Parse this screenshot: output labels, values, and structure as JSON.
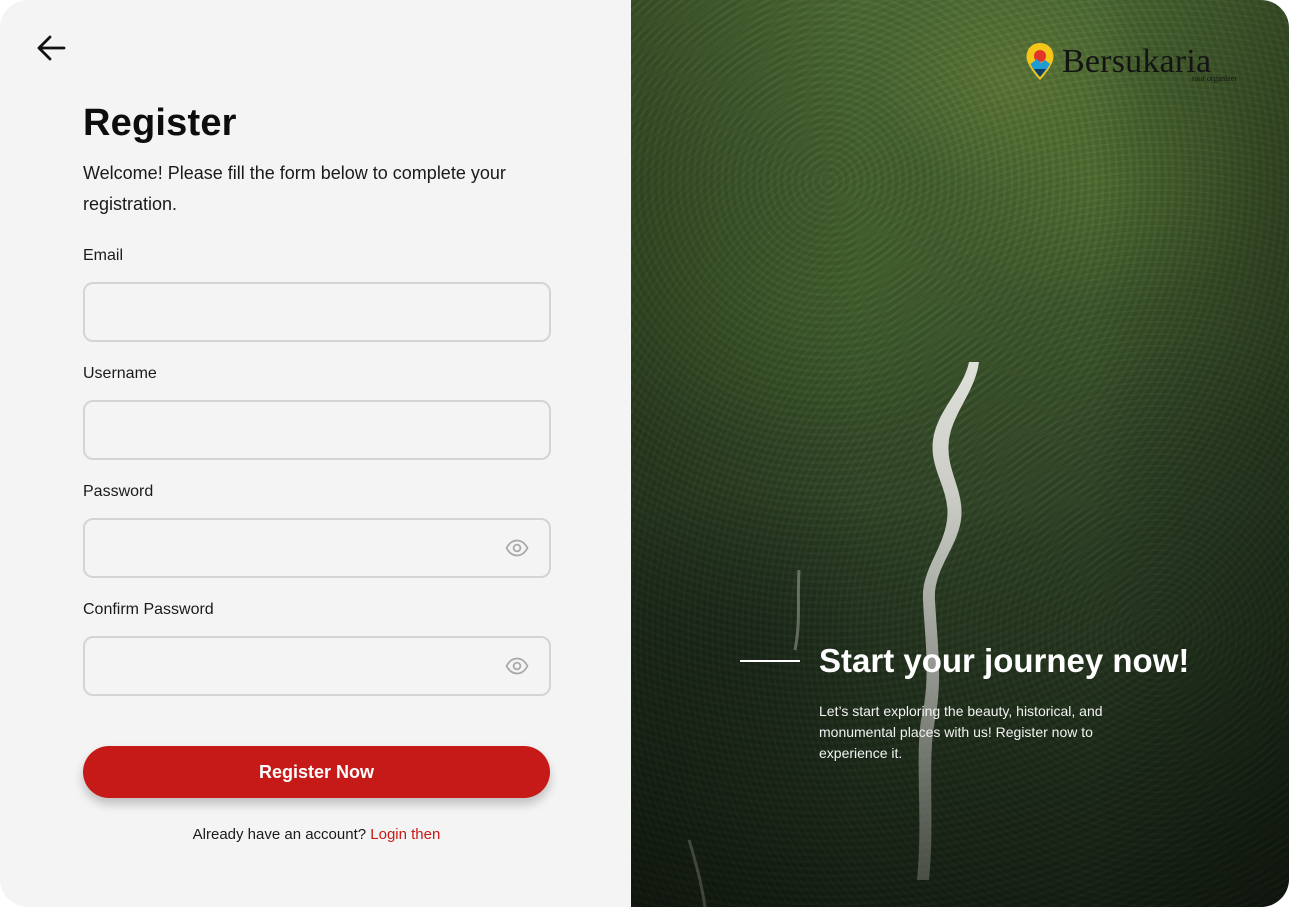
{
  "form": {
    "title": "Register",
    "subtitle": "Welcome! Please fill the form below to complete your registration.",
    "fields": {
      "email": {
        "label": "Email",
        "value": "",
        "placeholder": ""
      },
      "username": {
        "label": "Username",
        "value": "",
        "placeholder": ""
      },
      "password": {
        "label": "Password",
        "value": "",
        "placeholder": ""
      },
      "confirm_password": {
        "label": "Confirm Password",
        "value": "",
        "placeholder": ""
      }
    },
    "submit_label": "Register Now",
    "login_prompt": "Already have an account?",
    "login_link": "Login then"
  },
  "brand": {
    "name": "Bersukaria",
    "tagline": "tour organizer"
  },
  "hero": {
    "title": "Start your journey now!",
    "description": "Let’s start exploring the beauty, historical, and monumental places with us! Register now to experience it."
  },
  "icons": {
    "back": "arrow-left-icon",
    "password_toggle": "eye-icon",
    "logo_pin": "map-pin-icon"
  },
  "colors": {
    "accent": "#c61a18",
    "panel_bg": "#f4f4f4",
    "input_border": "#d4d4d4",
    "text": "#1a1a1a"
  }
}
